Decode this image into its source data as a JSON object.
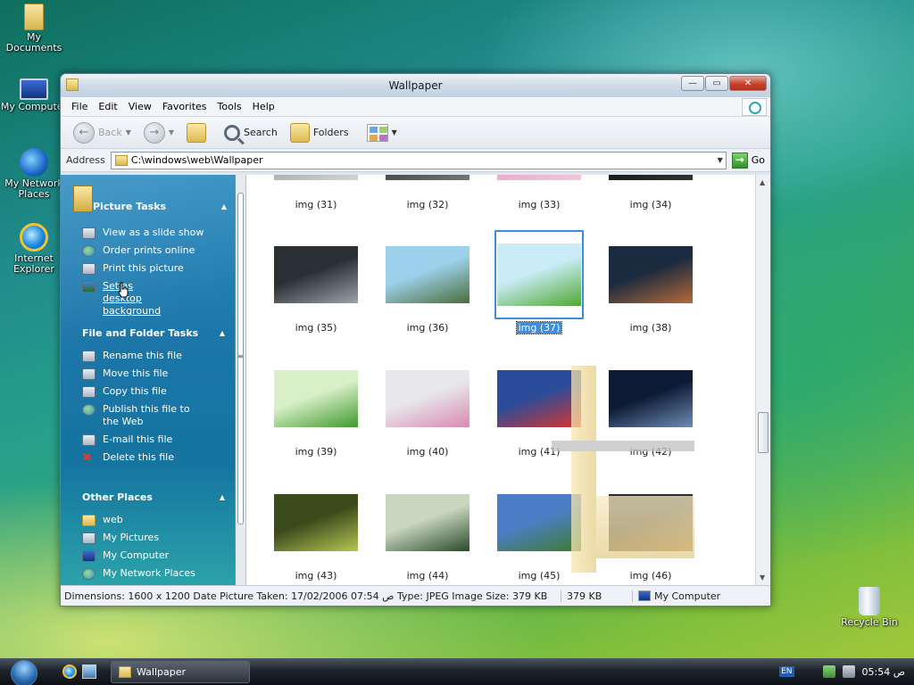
{
  "desktop": {
    "icons": [
      {
        "label": "My Documents",
        "icon": "folder-icon"
      },
      {
        "label": "My Computer",
        "icon": "computer-icon"
      },
      {
        "label": "My Network Places",
        "icon": "network-icon"
      },
      {
        "label": "Internet Explorer",
        "icon": "ie-icon"
      },
      {
        "label": "Recycle Bin",
        "icon": "recycle-bin-icon"
      }
    ]
  },
  "window": {
    "title": "Wallpaper",
    "controls": {
      "minimize": "—",
      "maximize": "▭",
      "close": "✕"
    },
    "menu": [
      "File",
      "Edit",
      "View",
      "Favorites",
      "Tools",
      "Help"
    ],
    "toolbar": {
      "back": "Back",
      "forward": "",
      "search": "Search",
      "folders": "Folders"
    },
    "address": {
      "label": "Address",
      "path": "C:\\windows\\web\\Wallpaper",
      "go": "Go"
    }
  },
  "taskpane": {
    "picture_tasks": {
      "title": "Picture Tasks",
      "items": [
        "View as a slide show",
        "Order prints online",
        "Print this picture",
        "Set as desktop background"
      ]
    },
    "file_tasks": {
      "title": "File and Folder Tasks",
      "items": [
        "Rename this file",
        "Move this file",
        "Copy this file",
        "Publish this file to the Web",
        "E-mail this file",
        "Delete this file"
      ]
    },
    "other_places": {
      "title": "Other Places",
      "items": [
        "web",
        "My Pictures",
        "My Computer",
        "My Network Places"
      ]
    }
  },
  "files": [
    {
      "name": "img (31)",
      "colors": [
        "#a3a3a3",
        "#d5d5d5"
      ]
    },
    {
      "name": "img (32)",
      "colors": [
        "#3b3b3b",
        "#777"
      ]
    },
    {
      "name": "img (33)",
      "colors": [
        "#e6a2c8",
        "#f1c8dd"
      ]
    },
    {
      "name": "img (34)",
      "colors": [
        "#111",
        "#333"
      ]
    },
    {
      "name": "img (35)",
      "colors": [
        "#2a2f33",
        "#9aa3a9"
      ]
    },
    {
      "name": "img (36)",
      "colors": [
        "#9dd0ea",
        "#4a6d3a"
      ]
    },
    {
      "name": "img (37)",
      "colors": [
        "#c9ecf7",
        "#4fa830"
      ]
    },
    {
      "name": "img (38)",
      "colors": [
        "#1a2a3f",
        "#b56a3a"
      ]
    },
    {
      "name": "img (39)",
      "colors": [
        "#d8efc7",
        "#3f9a2e"
      ]
    },
    {
      "name": "img (40)",
      "colors": [
        "#e8e8ea",
        "#d889b2"
      ]
    },
    {
      "name": "img (41)",
      "colors": [
        "#2a4c9a",
        "#d8362d"
      ]
    },
    {
      "name": "img (42)",
      "colors": [
        "#0c1a33",
        "#6d8bb5"
      ]
    },
    {
      "name": "img (43)",
      "colors": [
        "#3b4a1a",
        "#b6c552"
      ]
    },
    {
      "name": "img (44)",
      "colors": [
        "#c9d6c0",
        "#284a2a"
      ]
    },
    {
      "name": "img (45)",
      "colors": [
        "#4a7fc7",
        "#3f7a2e"
      ]
    },
    {
      "name": "img (46)",
      "colors": [
        "#2b2a33",
        "#a8753c"
      ]
    }
  ],
  "selected_file": "img (37)",
  "status": {
    "details": "Dimensions: 1600 x 1200 Date Picture Taken: 17/02/2006 07:54 ص Type: JPEG Image Size: 379 KB",
    "size": "379 KB",
    "zone": "My Computer"
  },
  "taskbar": {
    "task": "Wallpaper",
    "lang": "EN",
    "clock": "ص 05:54"
  }
}
